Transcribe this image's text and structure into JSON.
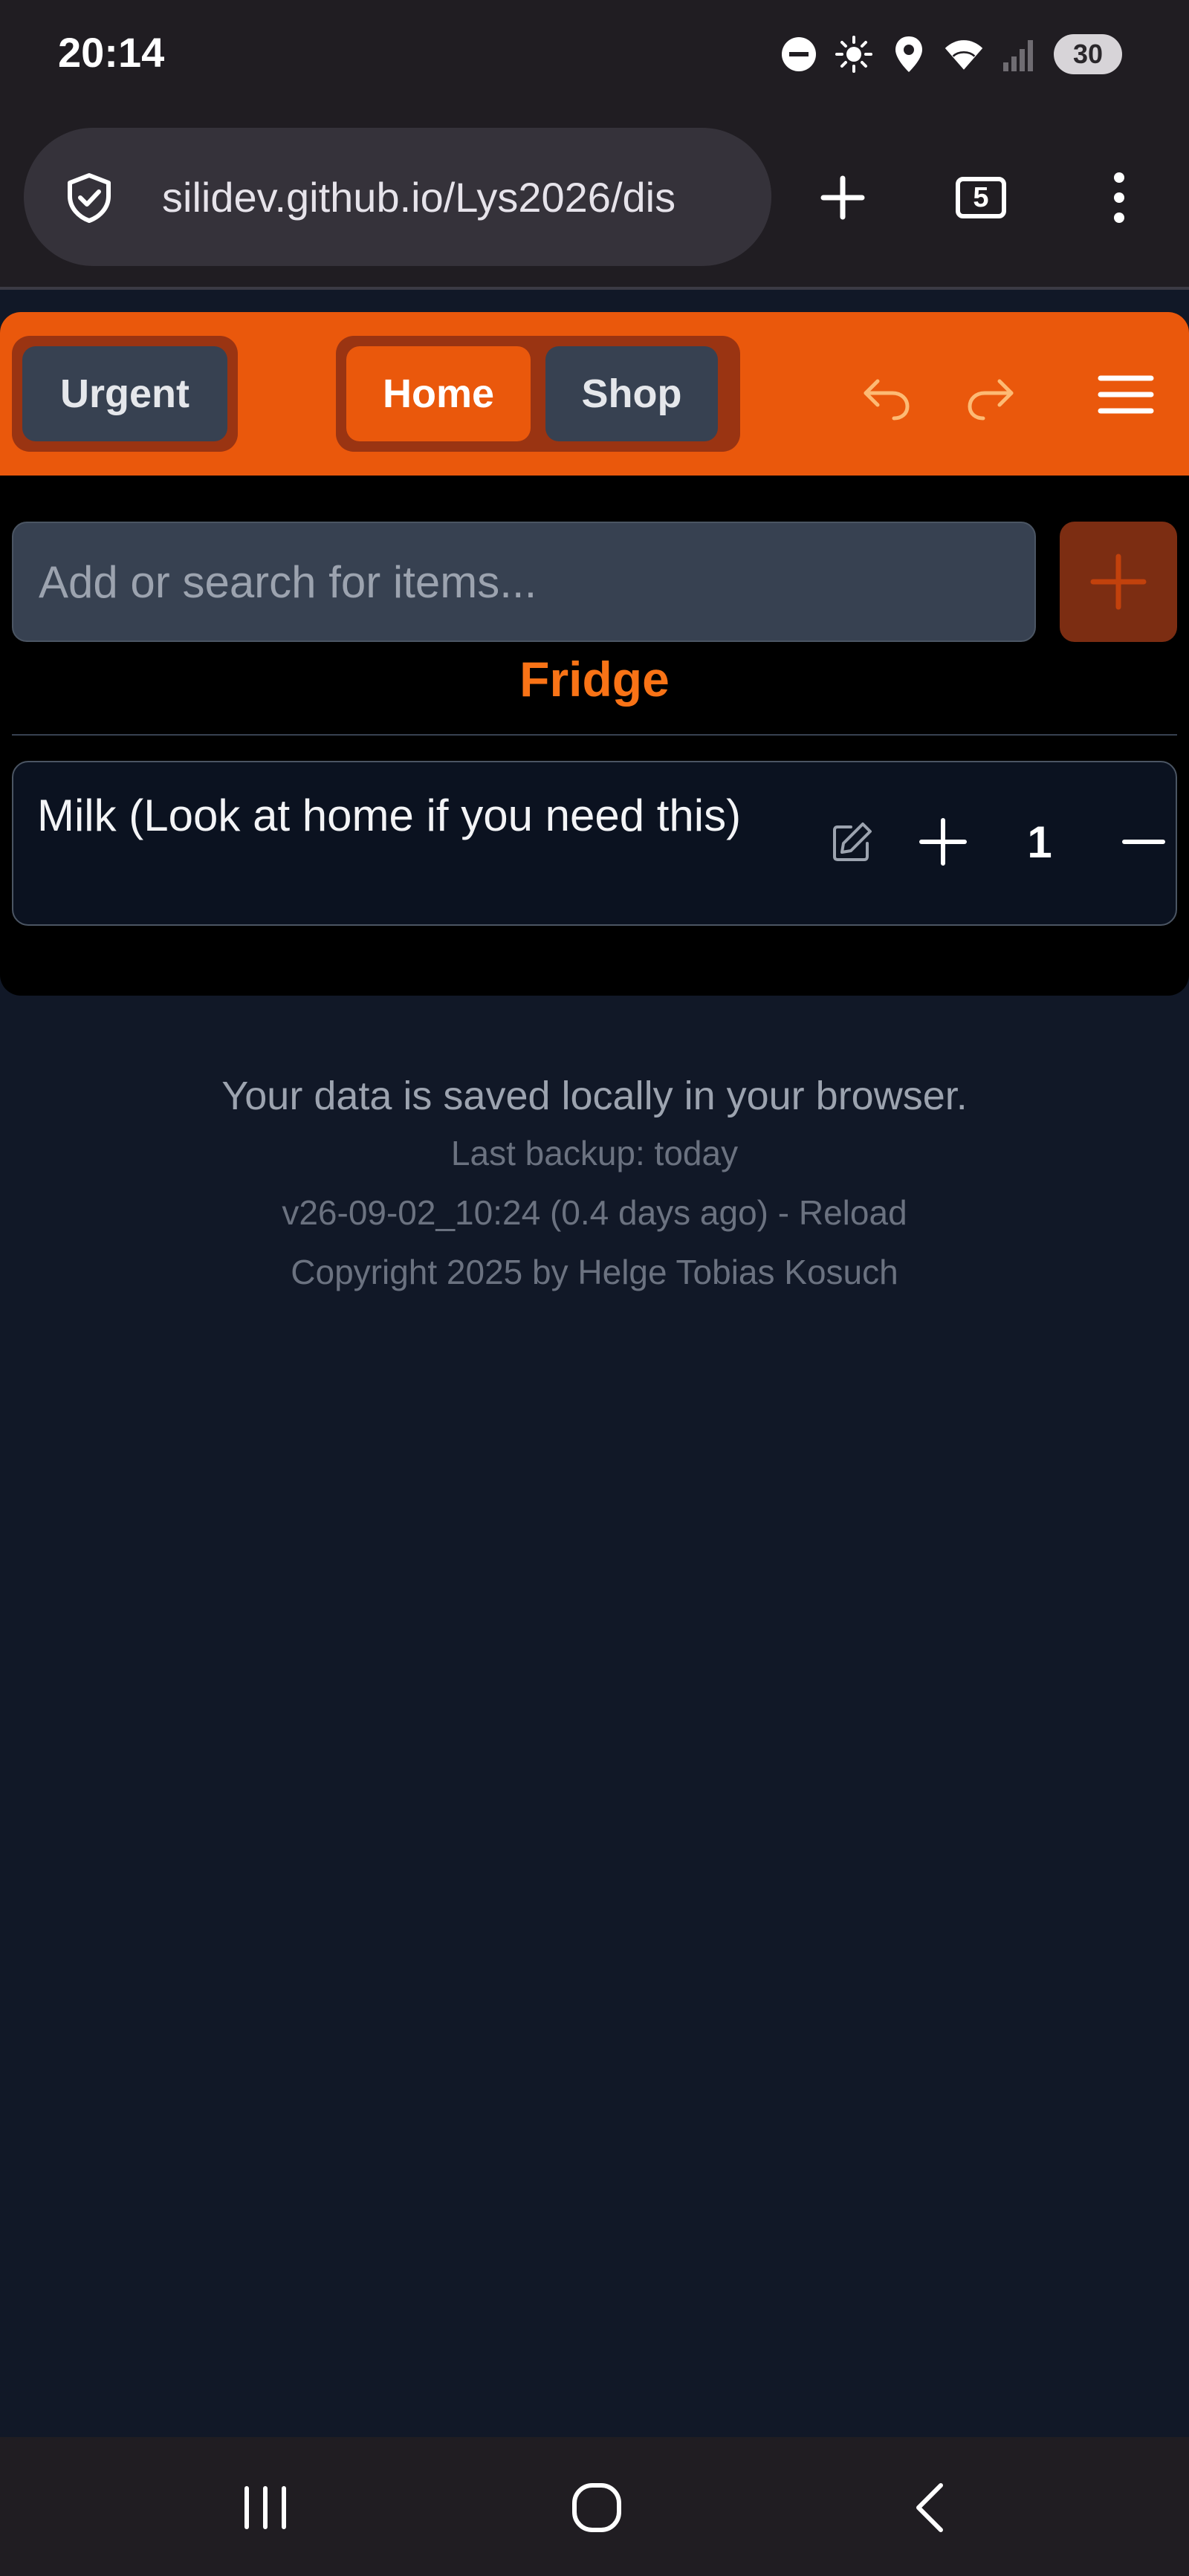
{
  "status_bar": {
    "time": "20:14",
    "battery": "30",
    "icons": [
      "do-not-disturb-icon",
      "brightness-icon",
      "location-icon",
      "wifi-icon",
      "signal-icon",
      "battery-icon"
    ]
  },
  "browser": {
    "url": "silidev.github.io/Lys2026/dis",
    "tab_count": "5",
    "icons": [
      "shield-icon",
      "new-tab-icon",
      "tabs-icon",
      "more-menu-icon"
    ]
  },
  "header": {
    "urgent_label": "Urgent",
    "tabs": [
      {
        "label": "Home",
        "active": true
      },
      {
        "label": "Shop",
        "active": false
      }
    ],
    "icons": [
      "undo-icon",
      "redo-icon",
      "hamburger-menu-icon"
    ]
  },
  "search": {
    "placeholder": "Add or search for items...",
    "add_icon": "plus-icon"
  },
  "section": {
    "title": "Fridge"
  },
  "items": [
    {
      "name": "Milk (Look at home if you need this)",
      "quantity": "1"
    }
  ],
  "footer": {
    "saved_note": "Your data is saved locally in your browser.",
    "backup": "Last backup: today",
    "version": "v26-09-02_10:24 (0.4 days ago) - Reload",
    "copyright": "Copyright 2025 by Helge Tobias Kosuch"
  },
  "navigation_bar": {
    "icons": [
      "recent-apps-icon",
      "home-icon",
      "back-icon"
    ]
  },
  "colors": {
    "accent": "#ea580c",
    "accent_dark": "#9a3412",
    "title": "#f97316",
    "background": "#111827"
  }
}
